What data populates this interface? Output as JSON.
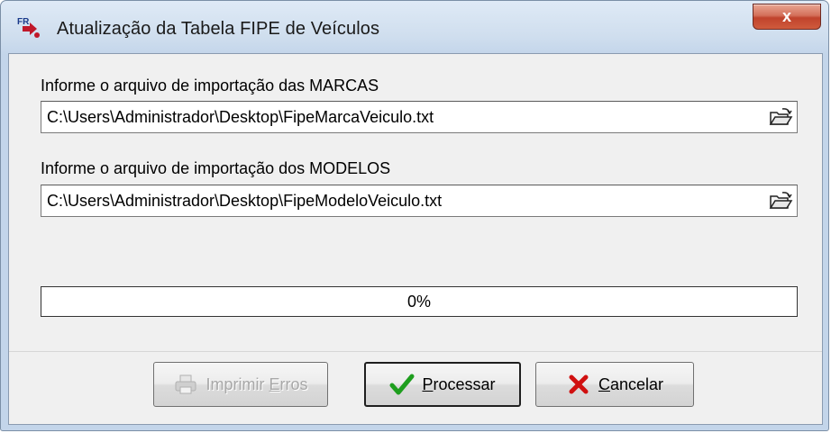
{
  "window": {
    "title": "Atualização da Tabela FIPE de Veículos",
    "close_label": "x"
  },
  "marcas": {
    "label": "Informe o arquivo de importação das MARCAS",
    "path": "C:\\Users\\Administrador\\Desktop\\FipeMarcaVeiculo.txt"
  },
  "modelos": {
    "label": "Informe o arquivo de importação dos MODELOS",
    "path": "C:\\Users\\Administrador\\Desktop\\FipeModeloVeiculo.txt"
  },
  "progress": {
    "value": 0,
    "text": "0%"
  },
  "buttons": {
    "print_pre": "Imprimir ",
    "print_ul": "E",
    "print_post": "rros",
    "process_ul": "P",
    "process_post": "rocessar",
    "cancel_ul": "C",
    "cancel_post": "ancelar"
  },
  "icons": {
    "app": "fipe-app-icon",
    "browse": "folder-open-icon",
    "print": "printer-icon",
    "process": "checkmark-icon",
    "cancel": "red-x-icon"
  },
  "colors": {
    "check": "#1e9e1e",
    "cancel_x": "#d01010",
    "close_button": "#c8503a"
  }
}
